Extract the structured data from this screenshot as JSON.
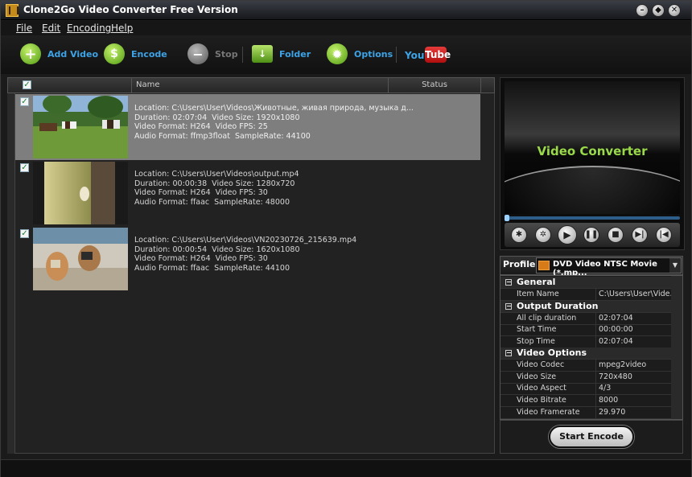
{
  "window": {
    "title": "Clone2Go Video Converter Free Version",
    "controls": [
      "minimize",
      "maximize",
      "close"
    ]
  },
  "menu": {
    "file": "File",
    "edit": "Edit",
    "encoding": "Encoding",
    "help": "Help"
  },
  "toolbar": {
    "add_video": "Add Video",
    "encode": "Encode",
    "stop": "Stop",
    "folder": "Folder",
    "options": "Options",
    "youtube_you": "You",
    "youtube_tube": "Tube"
  },
  "list": {
    "columns": {
      "name": "Name",
      "status": "Status"
    },
    "items": [
      {
        "checked": true,
        "selected": true,
        "location": "Location: C:\\Users\\User\\Videos\\Животные, живая природа, музыка д...",
        "duration": "Duration: 02:07:04",
        "size": "Video Size: 1920x1080",
        "format": "Video Format: H264",
        "fps": "Video FPS: 25",
        "audio": "Audio Format: ffmp3float",
        "rate": "SampleRate: 44100"
      },
      {
        "checked": true,
        "selected": false,
        "location": "Location: C:\\Users\\User\\Videos\\output.mp4",
        "duration": "Duration: 00:00:38",
        "size": "Video Size: 1280x720",
        "format": "Video Format: H264",
        "fps": "Video FPS: 30",
        "audio": "Audio Format: ffaac",
        "rate": "SampleRate: 48000"
      },
      {
        "checked": true,
        "selected": false,
        "location": "Location: C:\\Users\\User\\Videos\\VN20230726_215639.mp4",
        "duration": "Duration: 00:00:54",
        "size": "Video Size: 1620x1080",
        "format": "Video Format: H264",
        "fps": "Video FPS: 30",
        "audio": "Audio Format: ffaac",
        "rate": "SampleRate: 44100"
      }
    ]
  },
  "preview": {
    "title": "Video Converter"
  },
  "profile": {
    "label": "Profile",
    "selected": "DVD Video NTSC Movie (*.mp..."
  },
  "properties": {
    "general": "General",
    "item_name_label": "Item Name",
    "item_name_value": "C:\\Users\\User\\Vide...",
    "output_duration": "Output Duration",
    "all_clip_label": "All clip duration",
    "all_clip_value": "02:07:04",
    "start_time_label": "Start Time",
    "start_time_value": "00:00:00",
    "stop_time_label": "Stop Time",
    "stop_time_value": "02:07:04",
    "video_options": "Video Options",
    "codec_label": "Video Codec",
    "codec_value": "mpeg2video",
    "size_label": "Video Size",
    "size_value": "720x480",
    "aspect_label": "Video Aspect",
    "aspect_value": "4/3",
    "bitrate_label": "Video Bitrate",
    "bitrate_value": "8000",
    "framerate_label": "Video Framerate",
    "framerate_value": "29.970"
  },
  "encode": {
    "start": "Start Encode"
  },
  "colors": {
    "accent_blue": "#3da3e6",
    "preview_green": "#9ad94a",
    "youtube_red": "#c81e1e"
  }
}
